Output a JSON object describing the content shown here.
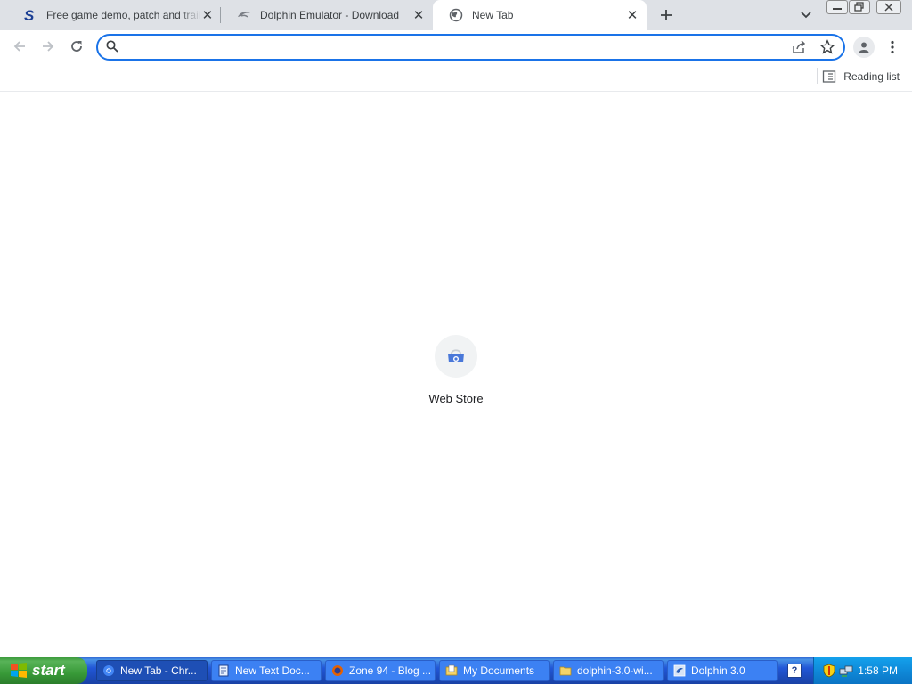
{
  "tabs": [
    {
      "title": "Free game demo, patch and trailer downloads",
      "favicon": "s-logo-icon",
      "active": false
    },
    {
      "title": "Dolphin Emulator - Download",
      "favicon": "dolphin-icon",
      "active": false
    },
    {
      "title": "New Tab",
      "favicon": "globe-icon",
      "active": true
    }
  ],
  "toolbar": {
    "omnibox_value": "",
    "omnibox_placeholder": ""
  },
  "bookmarks": {
    "reading_list_label": "Reading list"
  },
  "ntp": {
    "shortcut_label": "Web Store"
  },
  "taskbar": {
    "start_label": "start",
    "items": [
      {
        "label": "New Tab - Chr...",
        "icon": "chrome-icon",
        "active": true
      },
      {
        "label": "New Text Doc...",
        "icon": "notepad-icon",
        "active": false
      },
      {
        "label": "Zone 94 - Blog ...",
        "icon": "firefox-icon",
        "active": false
      },
      {
        "label": "My Documents",
        "icon": "folder-docs-icon",
        "active": false
      },
      {
        "label": "dolphin-3.0-wi...",
        "icon": "folder-icon",
        "active": false
      },
      {
        "label": "Dolphin 3.0",
        "icon": "dolphin-app-icon",
        "active": false
      }
    ],
    "clock": "1:58 PM"
  },
  "colors": {
    "accent": "#1a73e8",
    "tabstrip": "#dee1e6",
    "taskbar": "#245edb",
    "start": "#3c9a3c"
  }
}
